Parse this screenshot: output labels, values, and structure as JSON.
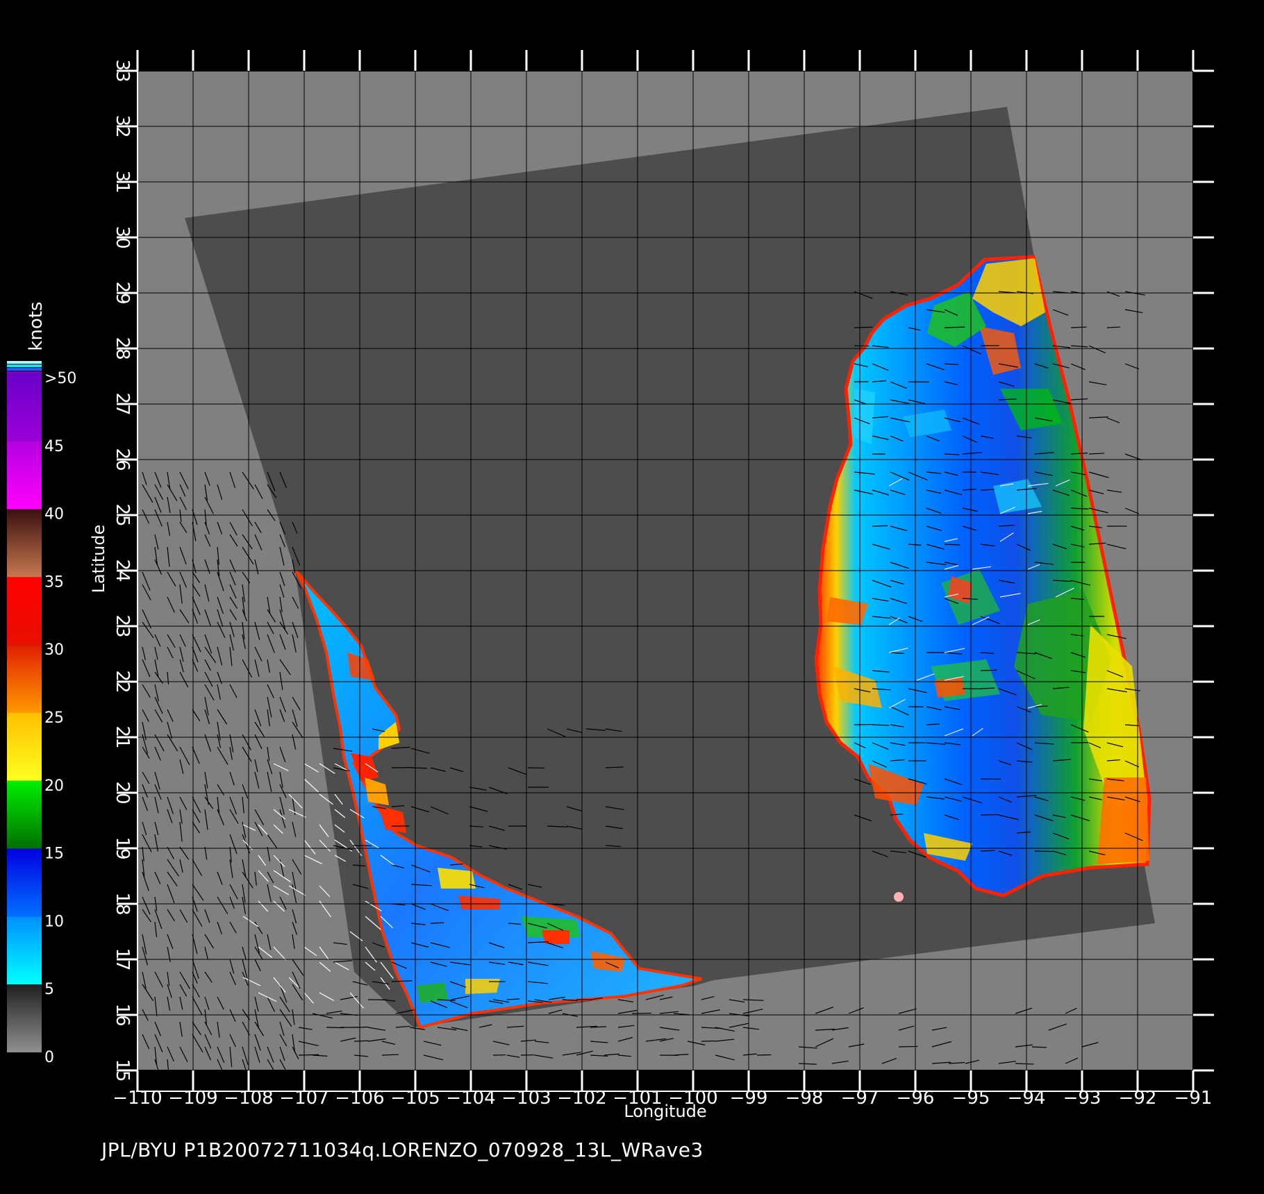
{
  "map": {
    "x_axis_label": "Longitude",
    "y_axis_label": "Latitude",
    "x_ticks": [
      "−110",
      "−109",
      "−108",
      "−107",
      "−106",
      "−105",
      "−104",
      "−103",
      "−102",
      "−101",
      "−100",
      "−99",
      "−98",
      "−97",
      "−96",
      "−95",
      "−94",
      "−93",
      "−92",
      "−91"
    ],
    "y_ticks": [
      "15",
      "16",
      "17",
      "18",
      "19",
      "20",
      "21",
      "22",
      "23",
      "24",
      "25",
      "26",
      "27",
      "28",
      "29",
      "30",
      "31",
      "32",
      "33"
    ],
    "lon_range": [
      -110,
      -91
    ],
    "lat_range": [
      15,
      33
    ],
    "background_color": "#808080",
    "swath_color": "#4d4d4d"
  },
  "colorbar": {
    "unit_label": "knots",
    "labels": [
      ">50",
      "45",
      "40",
      "35",
      "30",
      "25",
      "20",
      "15",
      "10",
      "5",
      "0"
    ],
    "bands": [
      {
        "from": 45,
        "to": 50,
        "top": "#6a00c8",
        "bottom": "#9a00d8"
      },
      {
        "from": 40,
        "to": 45,
        "top": "#b400e0",
        "bottom": "#ff00ff"
      },
      {
        "from": 35,
        "to": 40,
        "top": "#3a1010",
        "bottom": "#c87850"
      },
      {
        "from": 30,
        "to": 35,
        "top": "#ff0000",
        "bottom": "#e81000"
      },
      {
        "from": 25,
        "to": 30,
        "top": "#e02000",
        "bottom": "#ff9900"
      },
      {
        "from": 20,
        "to": 25,
        "top": "#ffc000",
        "bottom": "#ffff20"
      },
      {
        "from": 15,
        "to": 20,
        "top": "#00ee00",
        "bottom": "#007000"
      },
      {
        "from": 10,
        "to": 15,
        "top": "#0000e0",
        "bottom": "#0070ff"
      },
      {
        "from": 5,
        "to": 10,
        "top": "#0090ff",
        "bottom": "#00ffff"
      },
      {
        "from": 0,
        "to": 5,
        "top": "#202020",
        "bottom": "#909090"
      }
    ]
  },
  "caption": "JPL/BYU  P1B20072711034q.LORENZO_070928_13L_WRave3"
}
